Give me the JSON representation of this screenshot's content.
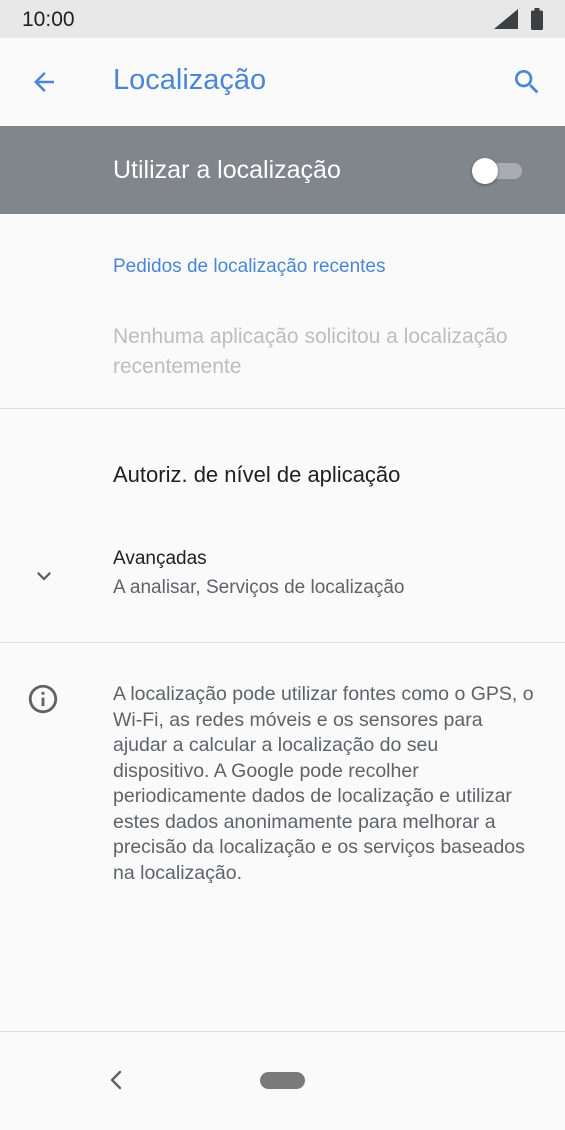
{
  "status_bar": {
    "time": "10:00",
    "signal_icon": "cell-signal-icon",
    "battery_icon": "battery-icon"
  },
  "app_bar": {
    "title": "Localização",
    "back_icon": "arrow-back-icon",
    "search_icon": "search-icon"
  },
  "master_switch": {
    "label": "Utilizar a localização",
    "state": "off"
  },
  "recent_requests": {
    "header": "Pedidos de localização recentes",
    "empty_text": "Nenhuma aplicação solicitou a localização recentemente"
  },
  "app_level_permissions": {
    "label": "Autoriz. de nível de aplicação"
  },
  "advanced": {
    "title": "Avançadas",
    "summary": "A analisar, Serviços de localização",
    "icon": "chevron-down-icon"
  },
  "footer_info": {
    "icon": "info-icon",
    "text": "A localização pode utilizar fontes como o GPS, o Wi-Fi, as redes móveis e os sensores para ajudar a calcular a localização do seu dispositivo. A Google pode recolher periodicamente dados de localização e utilizar estes dados anonimamente para melhorar a precisão da localização e os serviços baseados na localização."
  },
  "colors": {
    "accent": "#4a86d4",
    "master_bar": "#80868b",
    "background": "#fafafa"
  }
}
